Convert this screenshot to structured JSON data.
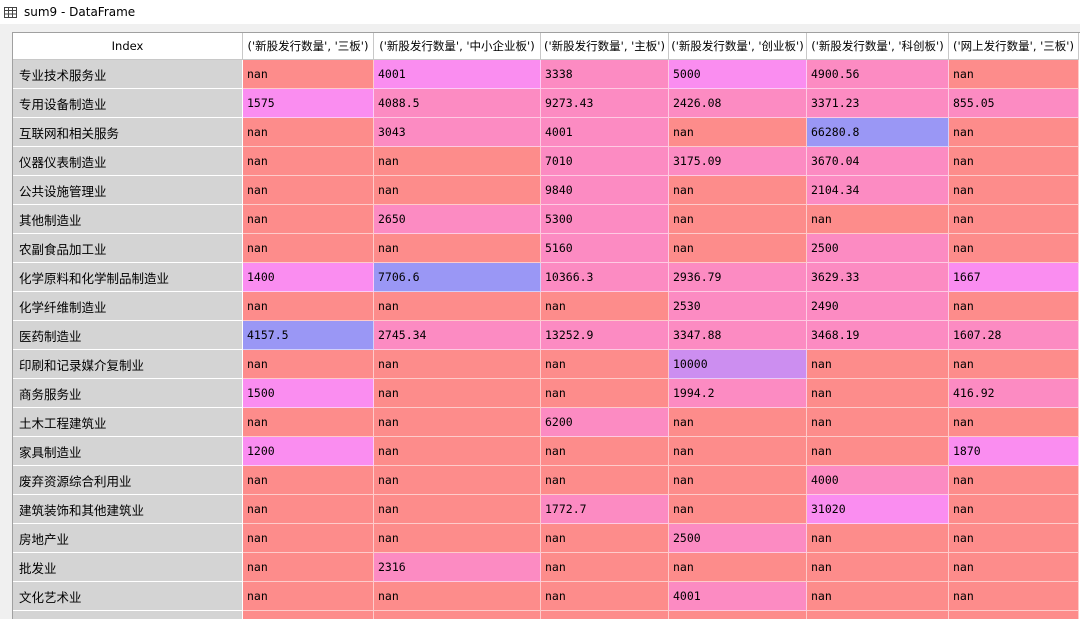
{
  "window": {
    "title": "sum9 - DataFrame"
  },
  "table": {
    "index_header": "Index",
    "columns": [
      "('新股发行数量', '三板')",
      "('新股发行数量', '中小企业板')",
      "('新股发行数量', '主板')",
      "('新股发行数量', '创业板')",
      "('新股发行数量', '科创板')",
      "('网上发行数量', '三板')"
    ],
    "colors": {
      "nan": "#fd8c8b",
      "pink": "#fc8bc2",
      "magenta": "#fa8df0",
      "violet": "#cc8ef0",
      "blue": "#9a97f5"
    },
    "rows": [
      {
        "index": "专业技术服务业",
        "values": [
          "nan",
          "4001",
          "3338",
          "5000",
          "4900.56",
          "nan"
        ],
        "colors": [
          "nan",
          "magenta",
          "pink",
          "magenta",
          "pink",
          "nan"
        ]
      },
      {
        "index": "专用设备制造业",
        "values": [
          "1575",
          "4088.5",
          "9273.43",
          "2426.08",
          "3371.23",
          "855.05"
        ],
        "colors": [
          "magenta",
          "pink",
          "pink",
          "pink",
          "pink",
          "pink"
        ]
      },
      {
        "index": "互联网和相关服务",
        "values": [
          "nan",
          "3043",
          "4001",
          "nan",
          "66280.8",
          "nan"
        ],
        "colors": [
          "nan",
          "pink",
          "pink",
          "nan",
          "blue",
          "nan"
        ]
      },
      {
        "index": "仪器仪表制造业",
        "values": [
          "nan",
          "nan",
          "7010",
          "3175.09",
          "3670.04",
          "nan"
        ],
        "colors": [
          "nan",
          "nan",
          "pink",
          "pink",
          "pink",
          "nan"
        ]
      },
      {
        "index": "公共设施管理业",
        "values": [
          "nan",
          "nan",
          "9840",
          "nan",
          "2104.34",
          "nan"
        ],
        "colors": [
          "nan",
          "nan",
          "pink",
          "nan",
          "pink",
          "nan"
        ]
      },
      {
        "index": "其他制造业",
        "values": [
          "nan",
          "2650",
          "5300",
          "nan",
          "nan",
          "nan"
        ],
        "colors": [
          "nan",
          "pink",
          "pink",
          "nan",
          "nan",
          "nan"
        ]
      },
      {
        "index": "农副食品加工业",
        "values": [
          "nan",
          "nan",
          "5160",
          "nan",
          "2500",
          "nan"
        ],
        "colors": [
          "nan",
          "nan",
          "pink",
          "nan",
          "pink",
          "nan"
        ]
      },
      {
        "index": "化学原料和化学制品制造业",
        "values": [
          "1400",
          "7706.6",
          "10366.3",
          "2936.79",
          "3629.33",
          "1667"
        ],
        "colors": [
          "magenta",
          "blue",
          "pink",
          "pink",
          "pink",
          "magenta"
        ]
      },
      {
        "index": "化学纤维制造业",
        "values": [
          "nan",
          "nan",
          "nan",
          "2530",
          "2490",
          "nan"
        ],
        "colors": [
          "nan",
          "nan",
          "nan",
          "pink",
          "pink",
          "nan"
        ]
      },
      {
        "index": "医药制造业",
        "values": [
          "4157.5",
          "2745.34",
          "13252.9",
          "3347.88",
          "3468.19",
          "1607.28"
        ],
        "colors": [
          "blue",
          "pink",
          "pink",
          "pink",
          "pink",
          "pink"
        ]
      },
      {
        "index": "印刷和记录媒介复制业",
        "values": [
          "nan",
          "nan",
          "nan",
          "10000",
          "nan",
          "nan"
        ],
        "colors": [
          "nan",
          "nan",
          "nan",
          "violet",
          "nan",
          "nan"
        ]
      },
      {
        "index": "商务服务业",
        "values": [
          "1500",
          "nan",
          "nan",
          "1994.2",
          "nan",
          "416.92"
        ],
        "colors": [
          "magenta",
          "nan",
          "nan",
          "pink",
          "nan",
          "pink"
        ]
      },
      {
        "index": "土木工程建筑业",
        "values": [
          "nan",
          "nan",
          "6200",
          "nan",
          "nan",
          "nan"
        ],
        "colors": [
          "nan",
          "nan",
          "pink",
          "nan",
          "nan",
          "nan"
        ]
      },
      {
        "index": "家具制造业",
        "values": [
          "1200",
          "nan",
          "nan",
          "nan",
          "nan",
          "1870"
        ],
        "colors": [
          "magenta",
          "nan",
          "nan",
          "nan",
          "nan",
          "magenta"
        ]
      },
      {
        "index": "废弃资源综合利用业",
        "values": [
          "nan",
          "nan",
          "nan",
          "nan",
          "4000",
          "nan"
        ],
        "colors": [
          "nan",
          "nan",
          "nan",
          "nan",
          "pink",
          "nan"
        ]
      },
      {
        "index": "建筑装饰和其他建筑业",
        "values": [
          "nan",
          "nan",
          "1772.7",
          "nan",
          "31020",
          "nan"
        ],
        "colors": [
          "nan",
          "nan",
          "pink",
          "nan",
          "magenta",
          "nan"
        ]
      },
      {
        "index": "房地产业",
        "values": [
          "nan",
          "nan",
          "nan",
          "2500",
          "nan",
          "nan"
        ],
        "colors": [
          "nan",
          "nan",
          "nan",
          "pink",
          "nan",
          "nan"
        ]
      },
      {
        "index": "批发业",
        "values": [
          "nan",
          "2316",
          "nan",
          "nan",
          "nan",
          "nan"
        ],
        "colors": [
          "nan",
          "pink",
          "nan",
          "nan",
          "nan",
          "nan"
        ]
      },
      {
        "index": "文化艺术业",
        "values": [
          "nan",
          "nan",
          "nan",
          "4001",
          "nan",
          "nan"
        ],
        "colors": [
          "nan",
          "nan",
          "nan",
          "pink",
          "nan",
          "nan"
        ]
      },
      {
        "index": "",
        "values": [
          "",
          "",
          "",
          "",
          "",
          ""
        ],
        "colors": [
          "nan",
          "nan",
          "nan",
          "nan",
          "nan",
          "nan"
        ]
      }
    ]
  }
}
